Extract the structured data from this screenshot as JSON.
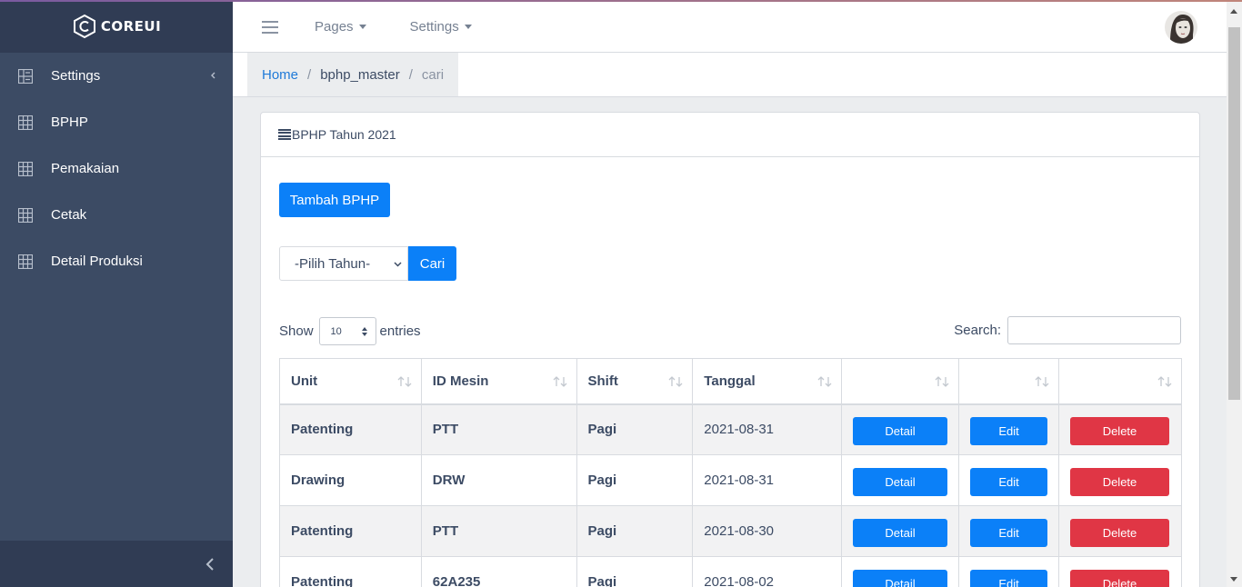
{
  "brand": {
    "name": "COREUI"
  },
  "sidebar": {
    "items": [
      {
        "label": "Settings",
        "icon": "settings-grid-icon"
      },
      {
        "label": "BPHP",
        "icon": "grid-icon"
      },
      {
        "label": "Pemakaian",
        "icon": "grid-icon"
      },
      {
        "label": "Cetak",
        "icon": "grid-icon"
      },
      {
        "label": "Detail Produksi",
        "icon": "grid-icon"
      }
    ]
  },
  "header": {
    "nav": [
      {
        "label": "Pages"
      },
      {
        "label": "Settings"
      }
    ]
  },
  "breadcrumb": {
    "home": "Home",
    "section": "bphp_master",
    "current": "cari"
  },
  "card": {
    "title": "BPHP Tahun 2021",
    "add_button": "Tambah BPHP",
    "year_select": "-Pilih Tahun-",
    "search_button": "Cari"
  },
  "datatable": {
    "show_label": "Show",
    "page_length": "10",
    "entries_label": "entries",
    "search_label": "Search:",
    "columns": [
      "Unit",
      "ID Mesin",
      "Shift",
      "Tanggal",
      "",
      "",
      ""
    ],
    "rows": [
      {
        "unit": "Patenting",
        "mesin": "PTT",
        "shift": "Pagi",
        "tanggal": "2021-08-31"
      },
      {
        "unit": "Drawing",
        "mesin": "DRW",
        "shift": "Pagi",
        "tanggal": "2021-08-31"
      },
      {
        "unit": "Patenting",
        "mesin": "PTT",
        "shift": "Pagi",
        "tanggal": "2021-08-30"
      },
      {
        "unit": "Patenting",
        "mesin": "62A235",
        "shift": "Pagi",
        "tanggal": "2021-08-02"
      }
    ],
    "actions": {
      "detail": "Detail",
      "edit": "Edit",
      "delete": "Delete"
    }
  },
  "colors": {
    "sidebar": "#3c4b64",
    "primary": "#0b80f8",
    "danger": "#e03645"
  }
}
